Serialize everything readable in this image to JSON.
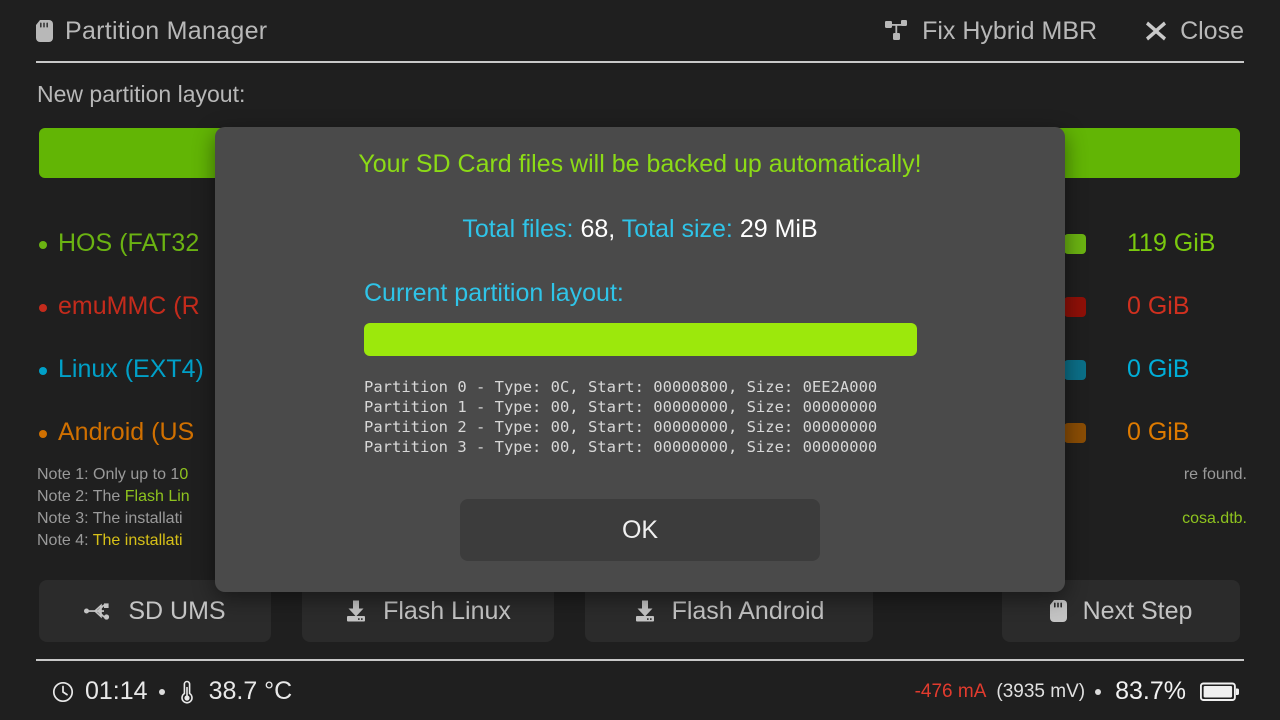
{
  "window": {
    "title": "Partition Manager",
    "title_icon": "sd-card-icon",
    "actions": [
      {
        "label": "Fix Hybrid MBR",
        "icon": "sitemap-icon"
      },
      {
        "label": "Close",
        "icon": "close-icon"
      }
    ]
  },
  "main": {
    "section_label": "New partition layout:",
    "new_layout_bar": [
      {
        "color": "#62b505",
        "percent": 100
      }
    ],
    "partitions": [
      {
        "label": "HOS (FAT32",
        "size": "119 GiB",
        "color": "#6bb312",
        "swatch": "#6bb312"
      },
      {
        "label": "emuMMC (R",
        "size": "0 GiB",
        "color": "#c42b1c",
        "swatch": "#8f1008"
      },
      {
        "label": "Linux (EXT4)",
        "size": "0 GiB",
        "color": "#00a0c8",
        "swatch": "#0b6f88"
      },
      {
        "label": "Android (US",
        "size": "0 GiB",
        "color": "#d07000",
        "swatch": "#8a4d05"
      }
    ],
    "notes": [
      {
        "prefix": "Note 1: Only up to 1",
        "mid": "0",
        "mid_class": "n-green",
        "suffix": "",
        "tail": "re found."
      },
      {
        "prefix": "Note 2: The ",
        "mid": "Flash Lin",
        "mid_class": "n-green",
        "suffix": "",
        "tail": ""
      },
      {
        "prefix": "Note 3: The installati",
        "mid": "",
        "mid_class": "",
        "suffix": "",
        "tail": "cosa.dtb."
      },
      {
        "prefix": "Note 4: ",
        "mid": "The installati",
        "mid_class": "n-yellow",
        "suffix": "",
        "tail": ""
      }
    ],
    "note_tails": [
      "",
      "",
      "re found.",
      "cosa.dtb."
    ],
    "buttons": [
      {
        "label": "SD UMS",
        "icon": "usb-icon"
      },
      {
        "label": "Flash Linux",
        "icon": "download-icon"
      },
      {
        "label": "Flash Android",
        "icon": "download-icon"
      },
      {
        "label": "Next Step",
        "icon": "sd-card-icon"
      }
    ]
  },
  "dialog": {
    "title": "Your SD Card files will be backed up automatically!",
    "total_files_label": "Total files:",
    "total_files_value": "68,",
    "total_size_label": "Total size:",
    "total_size_value": "29 MiB",
    "subtitle": "Current partition layout:",
    "layout_bar": [
      {
        "color": "#9ce80c",
        "percent": 100
      }
    ],
    "partition_table": "Partition 0 - Type: 0C, Start: 00000800, Size: 0EE2A000\nPartition 1 - Type: 00, Start: 00000000, Size: 00000000\nPartition 2 - Type: 00, Start: 00000000, Size: 00000000\nPartition 3 - Type: 00, Start: 00000000, Size: 00000000",
    "ok_label": "OK"
  },
  "status": {
    "time": "01:14",
    "temperature": "38.7 °C",
    "current": "-476 mA",
    "voltage": "(3935 mV)",
    "battery_percent": "83.7%",
    "clock_icon": "clock-icon",
    "temp_icon": "thermometer-icon",
    "battery_icon": "battery-icon"
  },
  "colors": {
    "background": "#1f1f1f",
    "dialog_bg": "#4a4a4a",
    "accent_cyan": "#2fc4e8",
    "accent_green": "#8cdb16",
    "warn_red": "#e23b2e"
  }
}
